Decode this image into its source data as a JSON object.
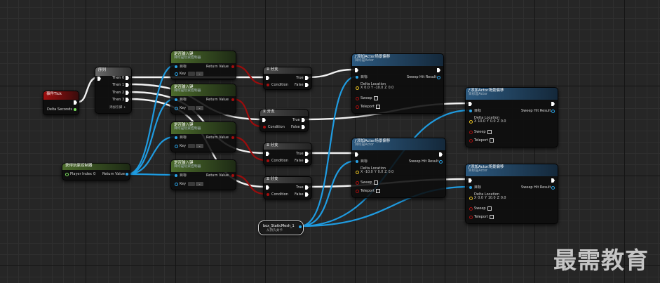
{
  "event_tick": {
    "title": "事件Tick",
    "delta_seconds": "Delta Seconds"
  },
  "sequence": {
    "title": "序列",
    "then0": "Then 0",
    "then1": "Then 1",
    "then2": "Then 2",
    "then3": "Then 3",
    "add_pin": "添加引脚",
    "plus": "+"
  },
  "player_controller": {
    "title": "获得玩家控制器",
    "player_index_label": "Player Index",
    "player_index_value": "0",
    "return_value": "Return Value"
  },
  "input_key_nodes": [
    {
      "title": "是否输入键",
      "subtitle": "目标是玩家控制器",
      "target": "目标",
      "key": "Key",
      "return_value": "Return Value"
    },
    {
      "title": "是否输入键",
      "subtitle": "目标是玩家控制器",
      "target": "目标",
      "key": "Key",
      "return_value": "Return Value"
    },
    {
      "title": "是否输入键",
      "subtitle": "目标是玩家控制器",
      "target": "目标",
      "key": "Key",
      "return_value": "Return Value"
    },
    {
      "title": "是否输入键",
      "subtitle": "目标是玩家控制器",
      "target": "目标",
      "key": "Key",
      "return_value": "Return Value"
    }
  ],
  "branch_nodes": [
    {
      "title": "分支",
      "condition": "Condition",
      "true_label": "True",
      "false_label": "False"
    },
    {
      "title": "分支",
      "condition": "Condition",
      "true_label": "True",
      "false_label": "False"
    },
    {
      "title": "分支",
      "condition": "Condition",
      "true_label": "True",
      "false_label": "False"
    },
    {
      "title": "分支",
      "condition": "Condition",
      "true_label": "True",
      "false_label": "False"
    }
  ],
  "add_offset_nodes": [
    {
      "title": "添加Actor场景偏移",
      "subtitle": "目标是Actor",
      "target": "目标",
      "sweep_hit": "Sweep Hit Result",
      "delta_location": "Delta Location",
      "x": "10.0",
      "y": "0.0",
      "z": "0.0",
      "sweep": "Sweep",
      "teleport": "Teleport"
    },
    {
      "title": "添加Actor场景偏移",
      "subtitle": "目标是Actor",
      "target": "目标",
      "sweep_hit": "Sweep Hit Result",
      "delta_location": "Delta Location",
      "x": "0.0",
      "y": "-10.0",
      "z": "0.0",
      "sweep": "Sweep",
      "teleport": "Teleport"
    },
    {
      "title": "添加Actor场景偏移",
      "subtitle": "目标是Actor",
      "target": "目标",
      "sweep_hit": "Sweep Hit Result",
      "delta_location": "Delta Location",
      "x": "-10.0",
      "y": "0.0",
      "z": "0.0",
      "sweep": "Sweep",
      "teleport": "Teleport"
    },
    {
      "title": "添加Actor场景偏移",
      "subtitle": "目标是Actor",
      "target": "目标",
      "sweep_hit": "Sweep Hit Result",
      "delta_location": "Delta Location",
      "x": "0.0",
      "y": "10.0",
      "z": "0.0",
      "sweep": "Sweep",
      "teleport": "Teleport"
    }
  ],
  "static_mesh_ref": {
    "title": "box_StaticMesh_1",
    "subtitle": "从持久关卡"
  },
  "watermark": "最需教育",
  "colors": {
    "exec": "#ffffff",
    "object_pin": "#2aa3e6",
    "bool_pin": "#a40f0f",
    "float_pin": "#7be05c",
    "vector_pin": "#e8c020"
  }
}
